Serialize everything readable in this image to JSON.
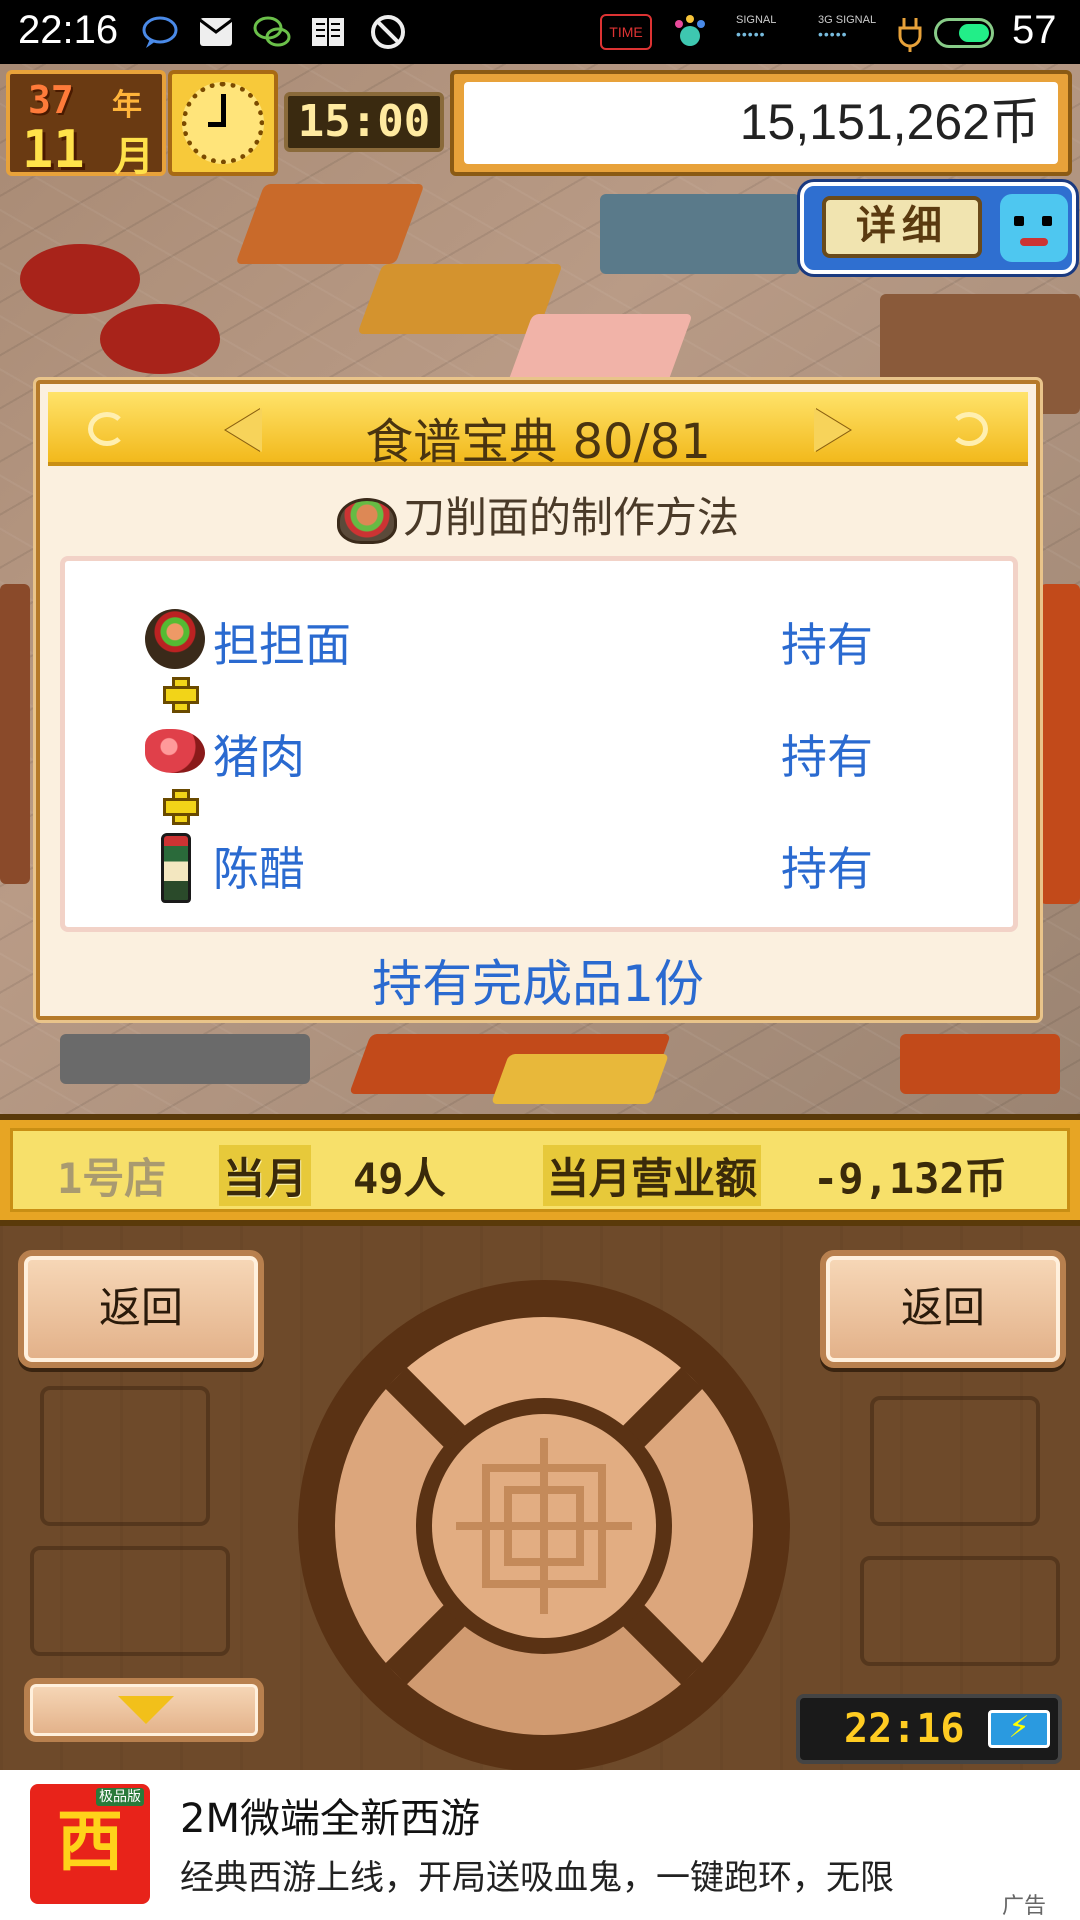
{
  "status_bar": {
    "time": "22:16",
    "time_badge": "TIME",
    "signal1_label": "SIGNAL",
    "signal2_label": "3G SIGNAL",
    "signal_dots": "•••••",
    "battery": "57",
    "icons": [
      "chat-bubble-icon",
      "mail-icon",
      "wechat-icon",
      "reader-icon",
      "no-disturb-icon",
      "paw-app-icon",
      "signal-icon",
      "charging-icon",
      "battery-icon"
    ]
  },
  "hud": {
    "year_value": "37",
    "year_unit": "年",
    "month_value": "11",
    "month_unit": "月",
    "clock_time": "15:00",
    "money": "15,151,262币",
    "detail_button": "详细"
  },
  "panel": {
    "title": "食谱宝典 80/81",
    "subtitle": "刀削面的制作方法",
    "ingredients": [
      {
        "name": "担担面",
        "status": "持有",
        "icon": "dandan-noodle-icon"
      },
      {
        "name": "猪肉",
        "status": "持有",
        "icon": "pork-icon"
      },
      {
        "name": "陈醋",
        "status": "持有",
        "icon": "vinegar-bottle-icon"
      }
    ],
    "summary": "持有完成品1份"
  },
  "stats": {
    "shop": "1号店",
    "month_label": "当月",
    "customers": "49人",
    "sales_label": "当月营业额",
    "sales_value": "-9,132币"
  },
  "controls": {
    "back_left": "返回",
    "back_right": "返回",
    "clock": "22:16"
  },
  "ad": {
    "logo_text": "西游",
    "logo_badge": "极品版",
    "title": "2M微端全新西游",
    "description": "经典西游上线，开局送吸血鬼，一键跑环，无限",
    "tag": "广告"
  },
  "colors": {
    "panel_text_blue": "#2a6ad0",
    "hud_gold": "#e8a23a",
    "control_brown": "#6e4a2a"
  }
}
